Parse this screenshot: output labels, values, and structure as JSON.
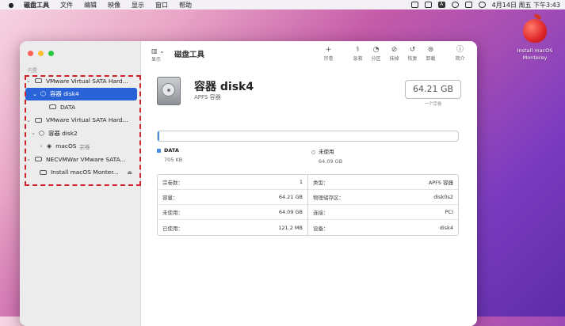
{
  "menubar": {
    "apple": "",
    "app": "磁盘工具",
    "menus": [
      "文件",
      "编辑",
      "映像",
      "显示",
      "窗口",
      "帮助"
    ],
    "clock": "4月14日 周五 下午3:43",
    "status_icon_letter": "A"
  },
  "sidebar": {
    "header": "内置",
    "items": [
      {
        "label": "VMware Virtual SATA Hard...",
        "level": 0,
        "chevron": "⌄",
        "kind": "disk"
      },
      {
        "label": "容器 disk4",
        "level": 1,
        "chevron": "⌄",
        "kind": "container",
        "selected": true
      },
      {
        "label": "DATA",
        "level": 2,
        "chevron": "",
        "kind": "volume"
      },
      {
        "label": "VMware Virtual SATA Hard...",
        "level": 0,
        "chevron": "⌄",
        "kind": "disk"
      },
      {
        "label": "容器 disk2",
        "level": 1,
        "chevron": "⌄",
        "kind": "container"
      },
      {
        "label": "macOS",
        "tag": "宗卷",
        "level": 2,
        "chevron": "›",
        "kind": "stack"
      },
      {
        "label": "NECVMWar VMware SATA...",
        "level": 0,
        "chevron": "⌄",
        "kind": "disk"
      },
      {
        "label": "Install macOS Monter...",
        "level": 1,
        "chevron": "",
        "kind": "disk",
        "eject": "⏏"
      }
    ]
  },
  "toolbar": {
    "sidebar_icon": "▥ ⌄",
    "sidebar_caption": "显示",
    "title": "磁盘工具",
    "buttons": [
      {
        "icon": "+",
        "label": "宗卷"
      },
      {
        "icon": "⚕",
        "label": "急救"
      },
      {
        "icon": "◔",
        "label": "分区"
      },
      {
        "icon": "⊘",
        "label": "抹掉"
      },
      {
        "icon": "↺",
        "label": "恢复"
      },
      {
        "icon": "⊜",
        "label": "卸载"
      },
      {
        "icon": "ⓘ",
        "label": "简介"
      }
    ]
  },
  "volume": {
    "name": "容器 disk4",
    "subtitle": "APFS 容器",
    "capacity": "64.21 GB",
    "capacity_note": "一个宗卷"
  },
  "usage": {
    "used_fraction": 0.0011,
    "legend": [
      {
        "label": "DATA",
        "value": "705 KB"
      },
      {
        "label": "未使用",
        "value": "64.09 GB"
      }
    ]
  },
  "info": {
    "left": [
      {
        "k": "宗卷数：",
        "v": "1"
      },
      {
        "k": "容量：",
        "v": "64.21 GB"
      },
      {
        "k": "未使用：",
        "v": "64.09 GB"
      },
      {
        "k": "已使用：",
        "v": "121.2 MB"
      }
    ],
    "right": [
      {
        "k": "类型：",
        "v": "APFS 容器"
      },
      {
        "k": "物理储存区：",
        "v": "disk0s2"
      },
      {
        "k": "连接：",
        "v": "PCI"
      },
      {
        "k": "设备：",
        "v": "disk4"
      }
    ]
  },
  "desktop": {
    "icon_label": "Install macOS Monterey"
  },
  "colors": {
    "selection": "#2a63d7",
    "highlight_box": "#d0202a",
    "data_swatch": "#4a90e2"
  }
}
